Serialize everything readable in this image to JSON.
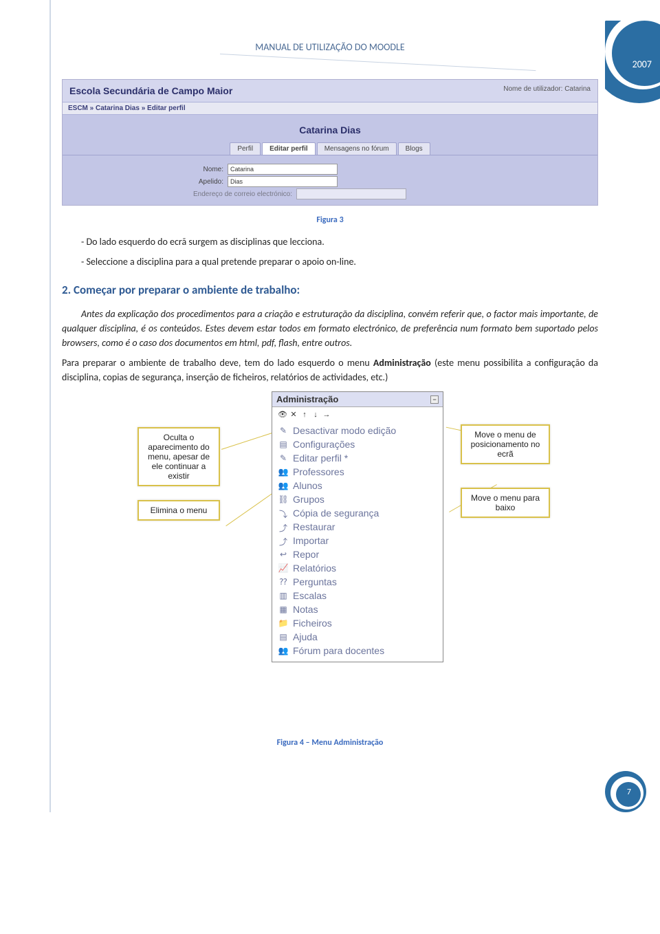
{
  "header_title": "MANUAL DE UTILIZAÇÃO DO MOODLE",
  "year": "2007",
  "page_number": "7",
  "shot1": {
    "school": "Escola Secundária de Campo Maior",
    "user_label": "Nome de utilizador: Catarina",
    "breadcrumb": "ESCM » Catarina Dias » Editar perfil",
    "profile_name": "Catarina Dias",
    "tabs": [
      "Perfil",
      "Editar perfil",
      "Mensagens no fórum",
      "Blogs"
    ],
    "rows": [
      {
        "label": "Nome:",
        "value": "Catarina"
      },
      {
        "label": "Apelido:",
        "value": "Dias"
      },
      {
        "label": "Endereço de correio electrónico:",
        "value": ""
      }
    ]
  },
  "fig3_caption": "Figura 3",
  "para1": "- Do lado esquerdo do ecrã surgem as disciplinas que lecciona.",
  "para2": "- Seleccione a disciplina para a qual pretende preparar o apoio on-line.",
  "section2": "2. Começar por preparar o ambiente de trabalho:",
  "para3": "Antes da explicação dos procedimentos para a criação e estruturação da disciplina, convém referir que, o factor mais importante, de qualquer disciplina, é os conteúdos. Estes devem estar todos em formato electrónico, de preferência num formato bem suportado pelos browsers, como é o caso dos documentos em html, pdf, flash, entre outros.",
  "para4_pre": "Para preparar o ambiente de trabalho deve, tem do lado esquerdo o menu ",
  "para4_bold": "Administração",
  "para4_post": " (este menu possibilita a configuração da disciplina, copias de segurança, inserção de ficheiros, relatórios de actividades, etc.)",
  "admin": {
    "title": "Administração",
    "toolbar_icons": [
      "eye",
      "x",
      "up",
      "down",
      "right"
    ],
    "items": [
      {
        "icon": "✎",
        "label": "Desactivar modo edição"
      },
      {
        "icon": "▤",
        "label": "Configurações"
      },
      {
        "icon": "✎",
        "label": "Editar perfil *"
      },
      {
        "icon": "👥",
        "label": "Professores"
      },
      {
        "icon": "👥",
        "label": "Alunos"
      },
      {
        "icon": "⛓",
        "label": "Grupos"
      },
      {
        "icon": "⤵",
        "label": "Cópia de segurança"
      },
      {
        "icon": "⤴",
        "label": "Restaurar"
      },
      {
        "icon": "⤴",
        "label": "Importar"
      },
      {
        "icon": "↩",
        "label": "Repor"
      },
      {
        "icon": "📈",
        "label": "Relatórios"
      },
      {
        "icon": "⁇",
        "label": "Perguntas"
      },
      {
        "icon": "▥",
        "label": "Escalas"
      },
      {
        "icon": "▦",
        "label": "Notas"
      },
      {
        "icon": "📁",
        "label": "Ficheiros"
      },
      {
        "icon": "▤",
        "label": "Ajuda"
      },
      {
        "icon": "👥",
        "label": "Fórum para docentes"
      }
    ]
  },
  "callouts": {
    "c1": "Oculta o aparecimento do menu, apesar de ele continuar a existir",
    "c2": "Elimina o menu",
    "c3": "Move o menu de posicionamento no ecrã",
    "c4": "Move o menu para baixo"
  },
  "fig4_caption": "Figura 4 – Menu Administração"
}
